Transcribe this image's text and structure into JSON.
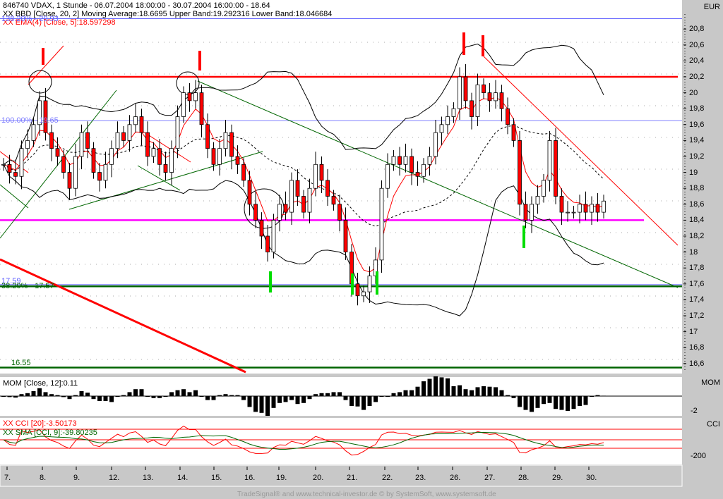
{
  "header": {
    "title": "846740  VDAX, 1 Stunde - 06.07.2004 18:00:00 - 30.07.2004 16:00:00 - 18.64",
    "bbd": "XX BBD [Close, 20, 2] Moving Average:18.6695 Upper Band:19.292316 Lower Band:18.046684",
    "ema": "XX EMA(4) [Close, 5]:18.597298"
  },
  "levels": [
    {
      "label": "138.20% - 20.93",
      "price": 20.93,
      "color": "#6060ff"
    },
    {
      "label": "",
      "price": 20.2,
      "color": "#ff0000"
    },
    {
      "label": "100.00% - 19.65",
      "price": 19.65,
      "color": "#8080ff"
    },
    {
      "label": "",
      "price": 18.4,
      "color": "#ff00ff"
    },
    {
      "label": "17.59",
      "price": 17.59,
      "color": "#6060ff"
    },
    {
      "label": "38.20% - 17.57",
      "price": 17.57,
      "color": "#006400"
    },
    {
      "label": "16.55",
      "price": 16.55,
      "color": "#006400"
    }
  ],
  "axis": {
    "currency": "EUR",
    "price_ticks": [
      "20,8",
      "20,6",
      "20,4",
      "20,2",
      "20",
      "19,8",
      "19,6",
      "19,4",
      "19,2",
      "19",
      "18,8",
      "18,6",
      "18,4",
      "18,2",
      "18",
      "17,8",
      "17,6",
      "17,4",
      "17,2",
      "17",
      "16,8",
      "16,6"
    ],
    "mom_label": "MOM",
    "mom_tick": "-2",
    "cci_label": "CCI",
    "cci_tick": "-200"
  },
  "indicators": {
    "mom": "MOM [Close, 12]:0.11",
    "cci": "XX CCI [20]:-3.50173",
    "cci_sma": "XX SMA [CCI, 9]:-39.80235"
  },
  "footer": "TradeSignal® and www.technical-investor.de © by  SystemSoft, www.systemsoft.de",
  "chart_data": {
    "type": "candlestick",
    "title": "846740 VDAX, 1 Stunde",
    "ylim": [
      16.5,
      21.0
    ],
    "x_ticks": [
      "7.",
      "8.",
      "9.",
      "12.",
      "13.",
      "14.",
      "15.",
      "16.",
      "19.",
      "20.",
      "21.",
      "22.",
      "23.",
      "26.",
      "27.",
      "28.",
      "29.",
      "30."
    ],
    "closes": [
      19.1,
      19.0,
      18.95,
      19.3,
      19.4,
      19.6,
      19.9,
      19.5,
      19.3,
      19.2,
      19.0,
      18.8,
      19.2,
      19.5,
      19.3,
      19.0,
      18.9,
      19.1,
      19.3,
      19.5,
      19.4,
      19.6,
      19.7,
      19.5,
      19.2,
      19.3,
      19.1,
      19.0,
      19.3,
      19.7,
      20.0,
      19.9,
      20.0,
      19.6,
      19.3,
      19.1,
      19.3,
      19.5,
      19.2,
      19.1,
      18.9,
      18.6,
      18.4,
      18.2,
      18.0,
      18.4,
      18.6,
      18.5,
      18.9,
      18.7,
      18.5,
      18.8,
      19.1,
      18.9,
      18.7,
      18.6,
      18.4,
      18.0,
      17.6,
      17.45,
      17.5,
      17.7,
      17.9,
      18.8,
      19.1,
      19.2,
      19.1,
      19.2,
      19.0,
      18.95,
      19.1,
      19.2,
      19.5,
      19.6,
      19.7,
      19.8,
      20.2,
      19.9,
      19.7,
      20.1,
      20.0,
      19.9,
      20.0,
      19.8,
      19.6,
      19.4,
      18.6,
      18.4,
      18.6,
      18.7,
      18.9,
      19.4,
      18.7,
      18.5,
      18.5,
      18.5,
      18.6,
      18.5,
      18.6,
      18.5,
      18.64
    ],
    "bollinger": {
      "period": 20,
      "stddev": 2
    },
    "ema_period": 5,
    "mom_period": 12,
    "cci_period": 20,
    "cci_sma_period": 9
  }
}
